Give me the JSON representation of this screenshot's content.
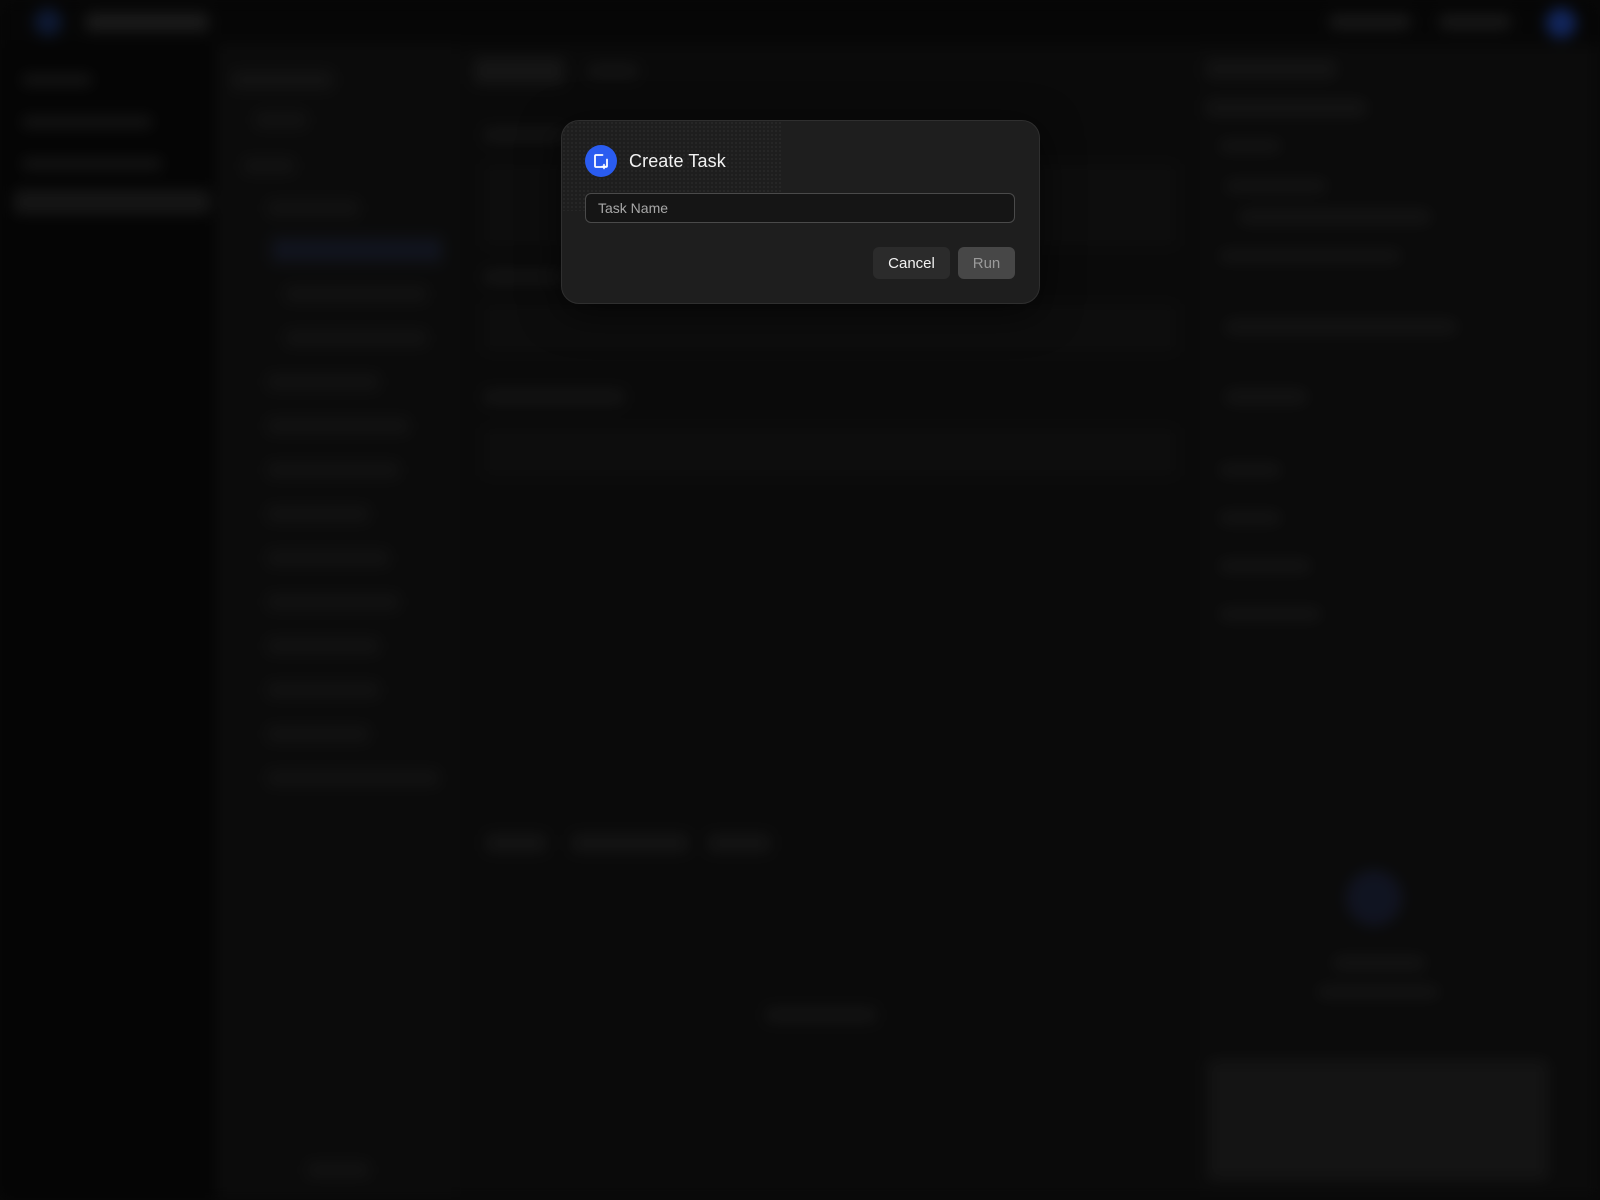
{
  "dialog": {
    "title": "Create Task",
    "icon": "add-task-icon",
    "task_name": {
      "value": "",
      "placeholder": "Task Name"
    },
    "cancel_label": "Cancel",
    "run_label": "Run",
    "run_enabled": false
  },
  "colors": {
    "accent": "#2a5cf0",
    "dialog_background": "#1e1e1e",
    "page_background": "#0d0d0d"
  }
}
